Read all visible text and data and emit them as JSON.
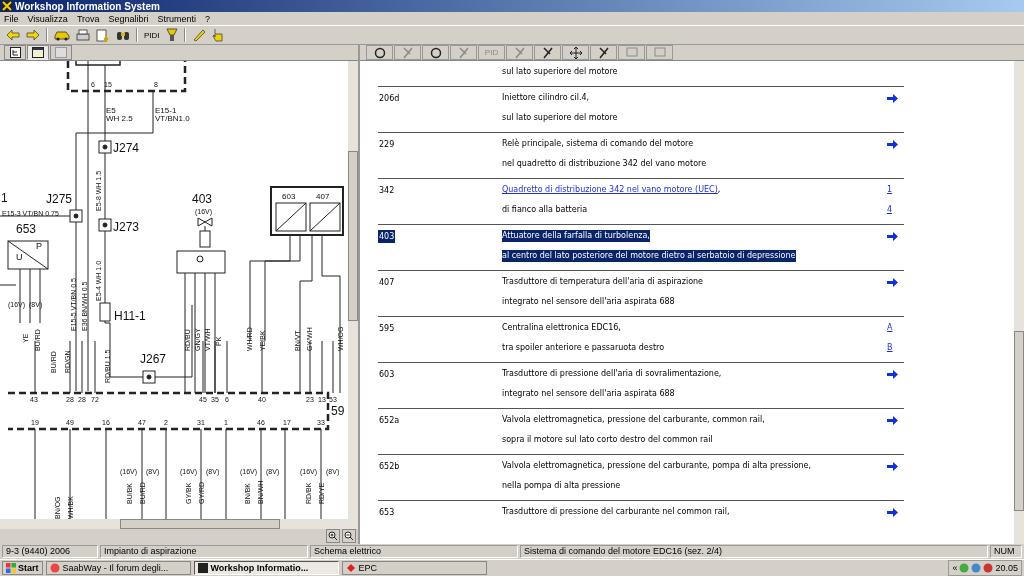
{
  "window": {
    "title": "Workshop Information System"
  },
  "menu": [
    "File",
    "Visualizza",
    "Trova",
    "Segnalibri",
    "Strumenti",
    "?"
  ],
  "toolbar": [
    {
      "kind": "icon"
    },
    {
      "kind": "icon"
    },
    {
      "kind": "icon"
    },
    {
      "kind": "icon"
    },
    {
      "kind": "icon"
    },
    {
      "kind": "icon"
    },
    {
      "kind": "text",
      "label": "PIDI"
    },
    {
      "kind": "icon"
    },
    {
      "kind": "icon"
    },
    {
      "kind": "icon"
    }
  ],
  "left_tabs": [
    {
      "selected": false
    },
    {
      "selected": true
    },
    {
      "selected": false
    }
  ],
  "diagram": {
    "labels": [
      "6",
      "15",
      "8",
      "E5",
      "WH 2.5",
      "E15-1",
      "VT/BN1.0",
      "J274",
      "E5-8  WH  1.5",
      "1",
      "J275",
      "E15-3 VT/BN 0.75",
      "J273",
      "653",
      "403",
      "(16V)",
      "603",
      "407",
      "E5-4  WH  1.0",
      "E15-5 VT/BN 0.5",
      "E36 BN/WH 0.5",
      "H11-1",
      "RD/BU  1.5",
      "J267",
      "RD/BU",
      "GN/GY",
      "VT/WH",
      "PK",
      "WH/RD",
      "YE/BK",
      "BN/VT",
      "GY/WH",
      "WH/OG",
      "YE",
      "BU/RD",
      "BU/RD",
      "RD/GN",
      "43",
      "28",
      "28",
      "72",
      "45",
      "35",
      "6",
      "40",
      "23",
      "13",
      "53",
      "19",
      "49",
      "16",
      "47",
      "2",
      "31",
      "1",
      "46",
      "17",
      "33",
      "59",
      "BU/BK",
      "BU/RD",
      "GY/BK",
      "GY/RD",
      "BN/BK",
      "BN/WH",
      "RD/BK",
      "RD/YE",
      "BN/OG",
      "WH/BK",
      "P",
      "U",
      "(16V)",
      "(8V)",
      "(16V)",
      "(8V)",
      "(16V)",
      "(8V)",
      "(16V)",
      "(8V)",
      "(16V)",
      "(8V)"
    ]
  },
  "right_tools": [
    {
      "kind": "icon",
      "disabled": false
    },
    {
      "kind": "icon",
      "disabled": true
    },
    {
      "kind": "icon",
      "disabled": false
    },
    {
      "kind": "icon",
      "disabled": true
    },
    {
      "kind": "text",
      "label": "PID",
      "disabled": true
    },
    {
      "kind": "icon",
      "disabled": true
    },
    {
      "kind": "icon",
      "disabled": false
    },
    {
      "kind": "icon",
      "disabled": false
    },
    {
      "kind": "icon",
      "disabled": false
    },
    {
      "kind": "icon",
      "disabled": true
    },
    {
      "kind": "icon",
      "disabled": true
    }
  ],
  "components": [
    {
      "selected": false,
      "lines": [
        {
          "text": "sul lato superiore del motore",
          "link": false
        }
      ]
    },
    {
      "code": "206d",
      "selected": false,
      "lines": [
        {
          "text": "Iniettore cilindro cil.4,",
          "link": false
        },
        {
          "text": "sul lato superiore del motore",
          "link": false
        }
      ],
      "refs": [
        {
          "kind": "arrow"
        }
      ]
    },
    {
      "code": "229",
      "selected": false,
      "lines": [
        {
          "text": "Relè principale, sistema di comando del motore",
          "link": false
        },
        {
          "text": "nel quadretto di distribuzione 342 del vano motore",
          "link": false
        }
      ],
      "refs": [
        {
          "kind": "arrow"
        }
      ]
    },
    {
      "code": "342",
      "selected": false,
      "lines": [
        {
          "text": "Quadretto di distribuzione 342 nel vano motore (UEC)",
          "link": true,
          "suffix": ","
        },
        {
          "text": "di fianco alla batteria",
          "link": false
        }
      ],
      "refs": [
        {
          "kind": "link",
          "text": "1"
        },
        {
          "kind": "link",
          "text": "4"
        }
      ]
    },
    {
      "code": "403",
      "selected": true,
      "lines": [
        {
          "text": "Attuatore della farfalla di turbolenza,",
          "link": false
        },
        {
          "text": "al centro del lato posteriore del motore dietro al serbatoio di depressione",
          "link": false
        }
      ],
      "refs": [
        {
          "kind": "arrow"
        }
      ]
    },
    {
      "code": "407",
      "selected": false,
      "lines": [
        {
          "text": "Trasduttore di temperatura dell'aria di aspirazione",
          "link": false
        },
        {
          "text": "integrato nel sensore dell'aria aspirata 688",
          "link": false
        }
      ],
      "refs": [
        {
          "kind": "arrow"
        }
      ]
    },
    {
      "code": "595",
      "selected": false,
      "lines": [
        {
          "text": "Centralina elettronica EDC16,",
          "link": false
        },
        {
          "text": "tra spoiler anteriore e passaruota destro",
          "link": false
        }
      ],
      "refs": [
        {
          "kind": "link",
          "text": "A"
        },
        {
          "kind": "link",
          "text": "B"
        }
      ]
    },
    {
      "code": "603",
      "selected": false,
      "lines": [
        {
          "text": "Trasduttore di pressione dell'aria di sovralimentazione,",
          "link": false
        },
        {
          "text": "integrato nel sensore dell'aria aspirata 688",
          "link": false
        }
      ],
      "refs": [
        {
          "kind": "arrow"
        }
      ]
    },
    {
      "code": "652a",
      "selected": false,
      "lines": [
        {
          "text": "Valvola elettromagnetica, pressione del carburante, common rail,",
          "link": false
        },
        {
          "text": "sopra il motore sul lato corto destro del common rail",
          "link": false
        }
      ],
      "refs": [
        {
          "kind": "arrow"
        }
      ]
    },
    {
      "code": "652b",
      "selected": false,
      "lines": [
        {
          "text": "Valvola elettromagnetica, pressione del carburante, pompa di alta pressione,",
          "link": false
        },
        {
          "text": "nella pompa di alta pressione",
          "link": false
        }
      ],
      "refs": [
        {
          "kind": "arrow"
        }
      ]
    },
    {
      "code": "653",
      "selected": false,
      "lines": [
        {
          "text": "Trasduttore di pressione del carburante nel common rail,",
          "link": false
        }
      ],
      "refs": [
        {
          "kind": "arrow"
        }
      ]
    }
  ],
  "status_bar": [
    "9-3 (9440) 2006",
    "Impianto di aspirazione",
    "Schema elettrico",
    "Sistema di comando del motore EDC16 (sez. 2/4)",
    "NUM"
  ],
  "taskbar": {
    "start": "Start",
    "items": [
      {
        "label": "SaabWay - Il forum degli...",
        "selected": false
      },
      {
        "label": "Workshop Informatio...",
        "selected": true
      },
      {
        "label": "EPC",
        "selected": false
      }
    ],
    "tray_toggle": "«",
    "clock": "20.05"
  }
}
